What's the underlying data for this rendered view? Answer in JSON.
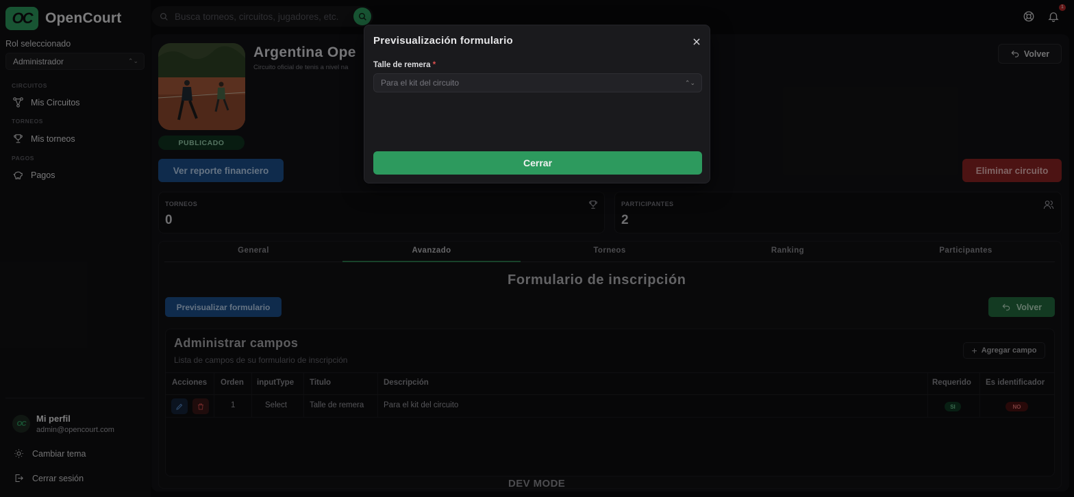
{
  "app": {
    "name": "OpenCourt",
    "logo_mark": "OC"
  },
  "search": {
    "placeholder": "Busca torneos, circuitos, jugadores, etc."
  },
  "topbar": {
    "notifications_count": "1"
  },
  "sidebar": {
    "role_label": "Rol seleccionado",
    "role_value": "Administrador",
    "sections": [
      {
        "title": "CIRCUITOS",
        "item": "Mis Circuitos"
      },
      {
        "title": "TORNEOS",
        "item": "Mis torneos"
      },
      {
        "title": "PAGOS",
        "item": "Pagos"
      }
    ],
    "profile_name": "Mi perfil",
    "profile_email": "admin@opencourt.com",
    "theme_label": "Cambiar tema",
    "logout_label": "Cerrar sesión"
  },
  "circuit": {
    "title": "Argentina Ope",
    "subtitle": "Circuito oficial de tenis a nivel na",
    "status": "PUBLICADO",
    "back_label": "Volver",
    "report_label": "Ver reporte financiero",
    "delete_label": "Eliminar circuito"
  },
  "stats": [
    {
      "label": "TORNEOS",
      "value": "0",
      "icon": "trophy-icon"
    },
    {
      "label": "PARTICIPANTES",
      "value": "2",
      "icon": "users-icon"
    }
  ],
  "tabs": [
    "General",
    "Avanzado",
    "Torneos",
    "Ranking",
    "Participantes"
  ],
  "active_tab": "Avanzado",
  "form_section": {
    "title": "Formulario de inscripción",
    "preview_label": "Previsualizar formulario",
    "back_label": "Volver",
    "fields_title": "Administrar campos",
    "fields_subtitle": "Lista de campos de su formulario de inscripción",
    "add_label": "Agregar campo"
  },
  "table": {
    "headers": [
      "Acciones",
      "Orden",
      "inputType",
      "Titulo",
      "Descripción",
      "Requerido",
      "Es identificador"
    ],
    "rows": [
      {
        "orden": "1",
        "inputType": "Select",
        "titulo": "Talle de remera",
        "descripcion": "Para el kit del circuito",
        "requerido": "SI",
        "identificador": "NO"
      }
    ]
  },
  "footer": {
    "dev_mode": "DEV MODE"
  },
  "modal": {
    "title": "Previsualización formulario",
    "field_label": "Talle de remera",
    "required_mark": "*",
    "select_placeholder": "Para el kit del circuito",
    "close_button": "Cerrar"
  },
  "colors": {
    "brand_green": "#2d9a5e",
    "primary_blue": "#1c4f8a",
    "danger_red": "#8a2323",
    "background": "#0a0a0b"
  }
}
